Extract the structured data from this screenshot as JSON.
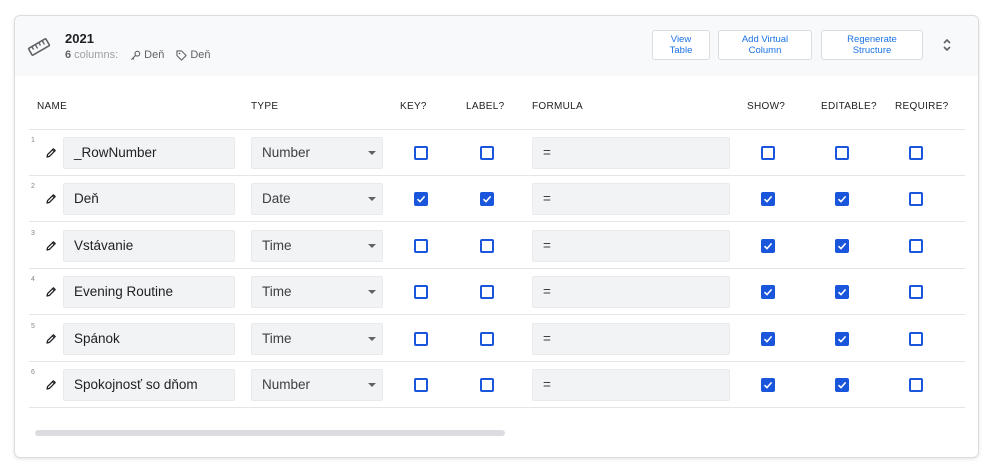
{
  "header": {
    "table_name": "2021",
    "column_count": "6",
    "columns_label": "columns:",
    "key_tag": "Deň",
    "label_tag": "Deň",
    "buttons": {
      "view_table": "View Table",
      "add_virtual_column": "Add Virtual Column",
      "regenerate_structure": "Regenerate Structure"
    }
  },
  "columns_headers": {
    "name": "NAME",
    "type": "TYPE",
    "key": "KEY?",
    "label": "LABEL?",
    "formula": "FORMULA",
    "show": "SHOW?",
    "editable": "EDITABLE?",
    "require": "REQUIRE?"
  },
  "rows": [
    {
      "num": "1",
      "name": "_RowNumber",
      "type": "Number",
      "formula": "=",
      "key": false,
      "label": false,
      "show": false,
      "editable": false,
      "require": false
    },
    {
      "num": "2",
      "name": "Deň",
      "type": "Date",
      "formula": "=",
      "key": true,
      "label": true,
      "show": true,
      "editable": true,
      "require": false
    },
    {
      "num": "3",
      "name": "Vstávanie",
      "type": "Time",
      "formula": "=",
      "key": false,
      "label": false,
      "show": true,
      "editable": true,
      "require": false
    },
    {
      "num": "4",
      "name": "Evening Routine",
      "type": "Time",
      "formula": "=",
      "key": false,
      "label": false,
      "show": true,
      "editable": true,
      "require": false
    },
    {
      "num": "5",
      "name": "Spánok",
      "type": "Time",
      "formula": "=",
      "key": false,
      "label": false,
      "show": true,
      "editable": true,
      "require": false
    },
    {
      "num": "6",
      "name": "Spokojnosť so dňom",
      "type": "Number",
      "formula": "=",
      "key": false,
      "label": false,
      "show": true,
      "editable": true,
      "require": false
    }
  ],
  "icons": {
    "table": "ruler-icon",
    "key": "key-icon",
    "label": "tag-icon",
    "edit": "pencil-icon",
    "collapse": "unfold-icon"
  },
  "colors": {
    "accent": "#1a56db",
    "link": "#1a73e8",
    "field_bg": "#f1f3f4"
  }
}
